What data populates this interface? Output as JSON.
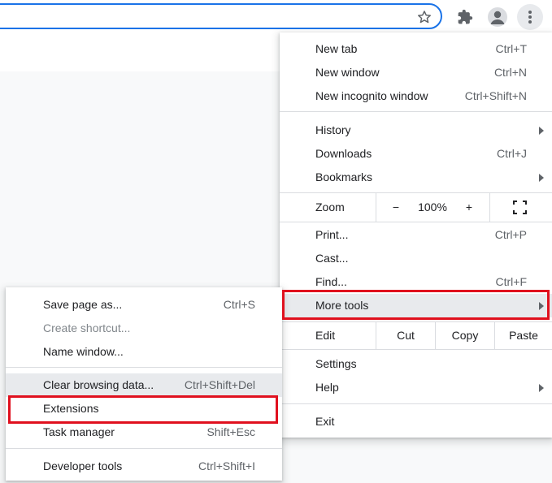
{
  "colors": {
    "accent": "#1a73e8",
    "highlight": "#e8eaed",
    "annotation_red": "#e0101e"
  },
  "toolbar": {
    "icons": [
      "star-icon",
      "puzzle-icon",
      "account-icon",
      "more-vert-icon"
    ]
  },
  "main_menu": {
    "new_tab": {
      "label": "New tab",
      "shortcut": "Ctrl+T"
    },
    "new_window": {
      "label": "New window",
      "shortcut": "Ctrl+N"
    },
    "new_incognito": {
      "label": "New incognito window",
      "shortcut": "Ctrl+Shift+N"
    },
    "history": {
      "label": "History"
    },
    "downloads": {
      "label": "Downloads",
      "shortcut": "Ctrl+J"
    },
    "bookmarks": {
      "label": "Bookmarks"
    },
    "zoom": {
      "label": "Zoom",
      "minus": "−",
      "value": "100%",
      "plus": "+"
    },
    "print": {
      "label": "Print...",
      "shortcut": "Ctrl+P"
    },
    "cast": {
      "label": "Cast..."
    },
    "find": {
      "label": "Find...",
      "shortcut": "Ctrl+F"
    },
    "more_tools": {
      "label": "More tools"
    },
    "edit": {
      "label": "Edit",
      "cut": "Cut",
      "copy": "Copy",
      "paste": "Paste"
    },
    "settings": {
      "label": "Settings"
    },
    "help": {
      "label": "Help"
    },
    "exit": {
      "label": "Exit"
    }
  },
  "sub_menu": {
    "save_page": {
      "label": "Save page as...",
      "shortcut": "Ctrl+S"
    },
    "create_shortcut": {
      "label": "Create shortcut..."
    },
    "name_window": {
      "label": "Name window..."
    },
    "clear_browsing": {
      "label": "Clear browsing data...",
      "shortcut": "Ctrl+Shift+Del"
    },
    "extensions": {
      "label": "Extensions"
    },
    "task_manager": {
      "label": "Task manager",
      "shortcut": "Shift+Esc"
    },
    "developer_tools": {
      "label": "Developer tools",
      "shortcut": "Ctrl+Shift+I"
    }
  }
}
